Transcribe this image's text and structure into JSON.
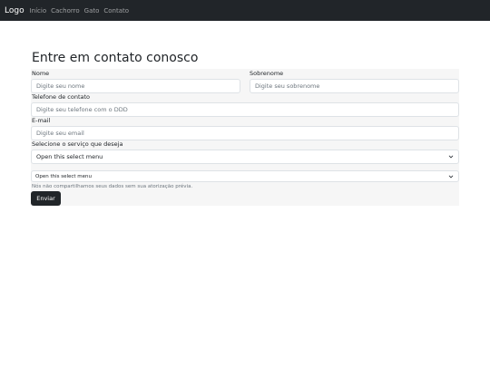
{
  "navbar": {
    "brand": "Logo",
    "links": [
      "Início",
      "Cachorro",
      "Gato",
      "Contato"
    ]
  },
  "form": {
    "title": "Entre em contato conosco",
    "first_name": {
      "label": "Nome",
      "placeholder": "Digite seu nome"
    },
    "last_name": {
      "label": "Sobrenome",
      "placeholder": "Digite seu sobrenome"
    },
    "phone": {
      "label": "Telefone de contato",
      "placeholder": "Digite seu telefone com o DDD"
    },
    "email": {
      "label": "E-mail",
      "placeholder": "Digite seu email"
    },
    "service": {
      "label": "Selecione o serviço que deseja",
      "value": "Open this select menu"
    },
    "service_small": {
      "value": "Open this select menu"
    },
    "help_text": "Nós não compartilhamos seus dados sem sua atorização prévia.",
    "submit_label": "Enviar"
  },
  "colors": {
    "navbar_bg": "#212529",
    "form_bg": "#f6f6f6",
    "button_bg": "#212529"
  },
  "icons": {
    "select_arrow": "chevron-down-icon"
  }
}
